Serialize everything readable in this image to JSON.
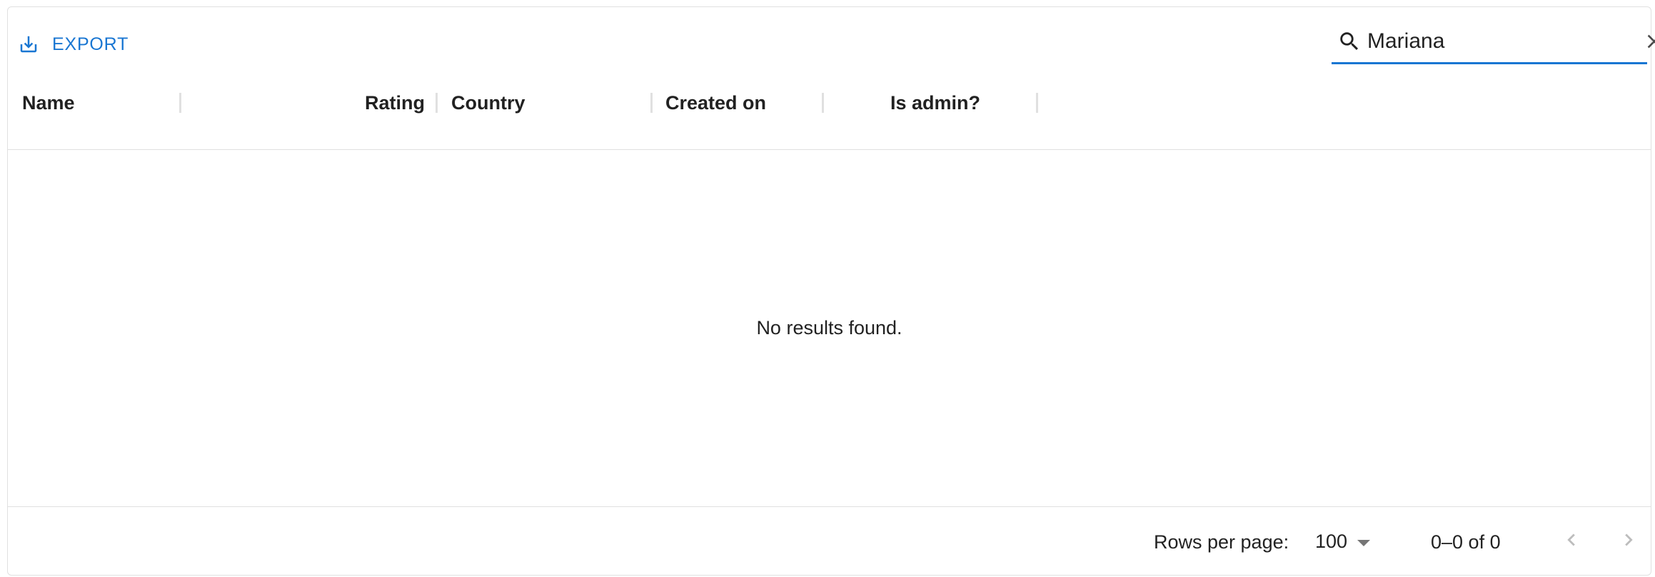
{
  "toolbar": {
    "export_label": "EXPORT",
    "export_icon": "download-icon",
    "search": {
      "value": "Mariana",
      "placeholder": "Search…",
      "search_icon": "search-icon",
      "clear_icon": "close-icon"
    }
  },
  "columns": [
    {
      "label": "Name",
      "align": "left"
    },
    {
      "label": "Rating",
      "align": "right"
    },
    {
      "label": "Country",
      "align": "left"
    },
    {
      "label": "Created on",
      "align": "left"
    },
    {
      "label": "Is admin?",
      "align": "center"
    }
  ],
  "body": {
    "empty_message": "No results found."
  },
  "footer": {
    "rows_per_page_label": "Rows per page:",
    "rows_per_page_value": "100",
    "page_range": "0–0 of 0",
    "prev_icon": "chevron-left-icon",
    "next_icon": "chevron-right-icon"
  },
  "colors": {
    "accent": "#1976d2",
    "border": "#e0e0e0",
    "text": "#212121",
    "disabled": "#bdbdbd"
  }
}
